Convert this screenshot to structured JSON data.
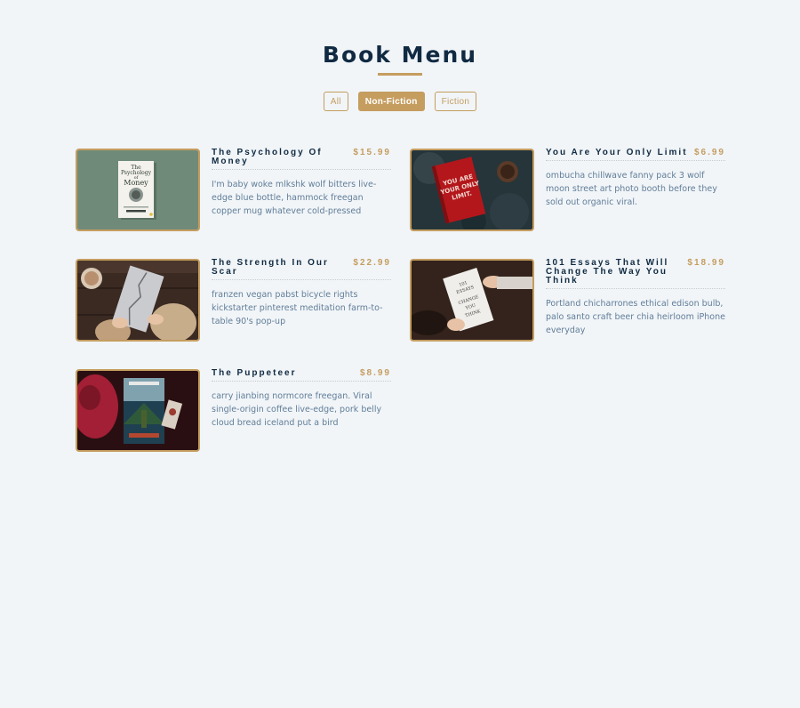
{
  "page": {
    "title": "Book Menu",
    "accent_color": "#c59d5f",
    "title_color": "#102a42",
    "text_color": "#617d98",
    "background": "#f1f5f8"
  },
  "filters": [
    {
      "label": "All",
      "active": false
    },
    {
      "label": "Non-Fiction",
      "active": true
    },
    {
      "label": "Fiction",
      "active": false
    }
  ],
  "items": [
    {
      "title": "The Psychology Of Money",
      "price": "$15.99",
      "description": "I'm baby woke mlkshk wolf bitters live-edge blue bottle, hammock freegan copper mug whatever cold-pressed",
      "image": "psychology-of-money-cover",
      "cover_text": [
        "The",
        "Psychology",
        "of",
        "Money"
      ]
    },
    {
      "title": "You Are Your Only Limit",
      "price": "$6.99",
      "description": "ombucha chillwave fanny pack 3 wolf moon street art photo booth before they sold out organic viral.",
      "image": "red-notebook-photo",
      "cover_text": [
        "YOU ARE",
        "YOUR ONLY",
        "LIMIT."
      ]
    },
    {
      "title": "The Strength In Our Scar",
      "price": "$22.99",
      "description": "franzen vegan pabst bicycle rights kickstarter pinterest meditation farm-to-table 90's pop-up",
      "image": "scar-book-photo"
    },
    {
      "title": "101 Essays That Will Change The Way You Think",
      "price": "$18.99",
      "description": "Portland chicharrones ethical edison bulb, palo santo craft beer chia heirloom iPhone everyday",
      "image": "essays-book-photo",
      "cover_text": [
        "101",
        "ESSAYS",
        "CHANGE",
        "YOU",
        "THINK"
      ]
    },
    {
      "title": "The Puppeteer",
      "price": "$8.99",
      "description": "carry jianbing normcore freegan. Viral single-origin coffee live-edge, pork belly cloud bread iceland put a bird",
      "image": "puppeteer-book-photo"
    }
  ]
}
